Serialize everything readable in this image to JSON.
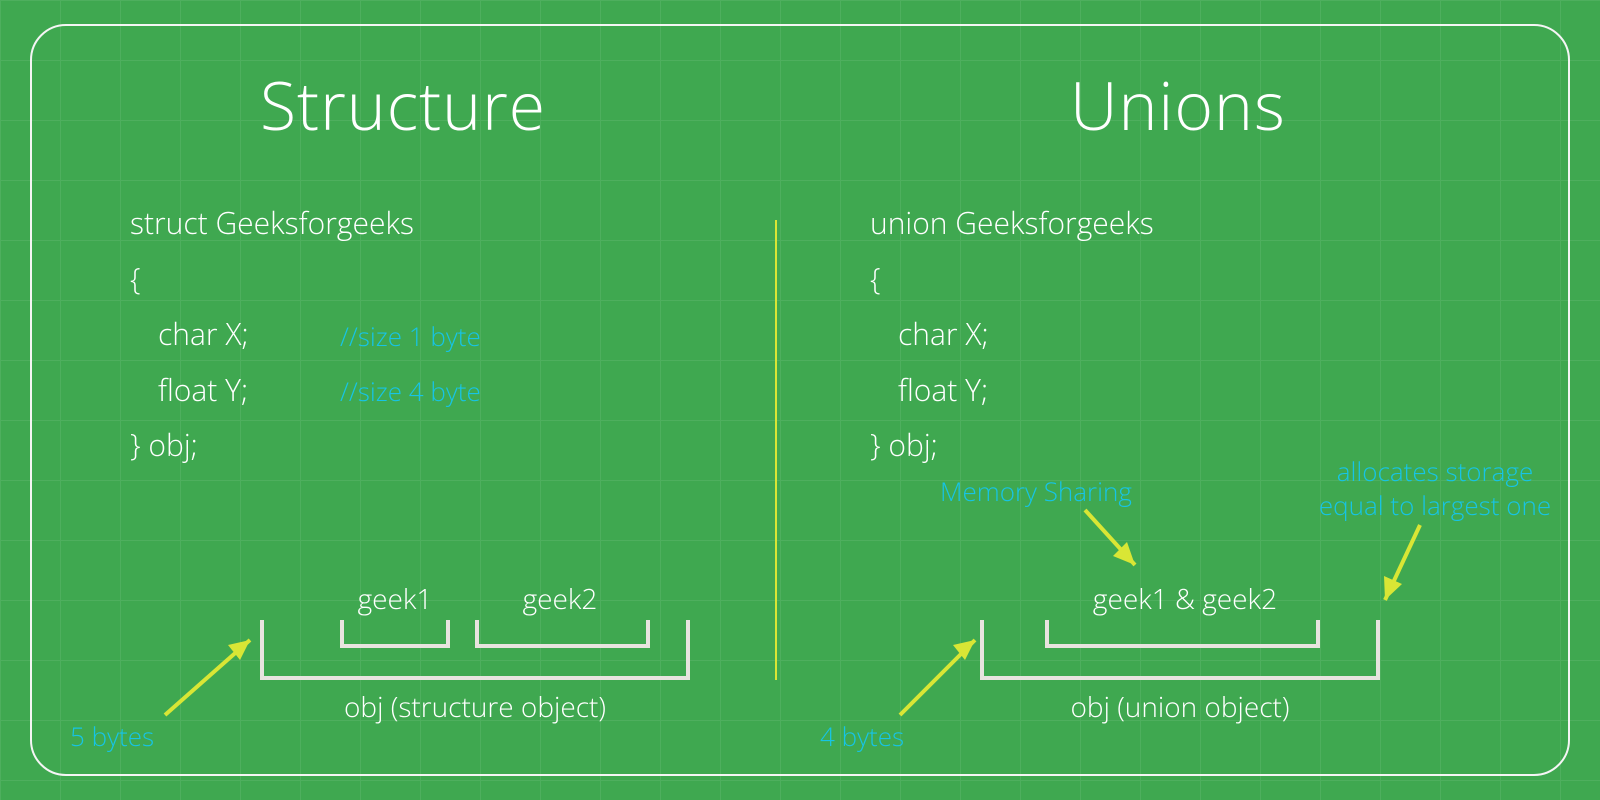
{
  "left": {
    "title": "Structure",
    "code": {
      "decl": "struct Geeksforgeeks",
      "open": "{",
      "member1": "char X;",
      "member2": "float Y;",
      "close": "} obj;"
    },
    "comments": {
      "size1": "//size 1 byte",
      "size4": "//size 4 byte"
    },
    "diagram": {
      "member1": "geek1",
      "member2": "geek2",
      "total_label": "obj (structure object)",
      "total_size": "5 bytes"
    }
  },
  "right": {
    "title": "Unions",
    "code": {
      "decl": "union Geeksforgeeks",
      "open": "{",
      "member1": "char X;",
      "member2": "float Y;",
      "close": "} obj;"
    },
    "diagram": {
      "shared": "geek1 & geek2",
      "total_label": "obj (union object)",
      "total_size": "4 bytes",
      "note_sharing": "Memory Sharing",
      "note_largest": "allocates storage equal to largest one"
    }
  },
  "colors": {
    "bg": "#3fa850",
    "accent": "#d9e635",
    "cyan": "#17c4e5",
    "frame": "#f5f5f5"
  }
}
